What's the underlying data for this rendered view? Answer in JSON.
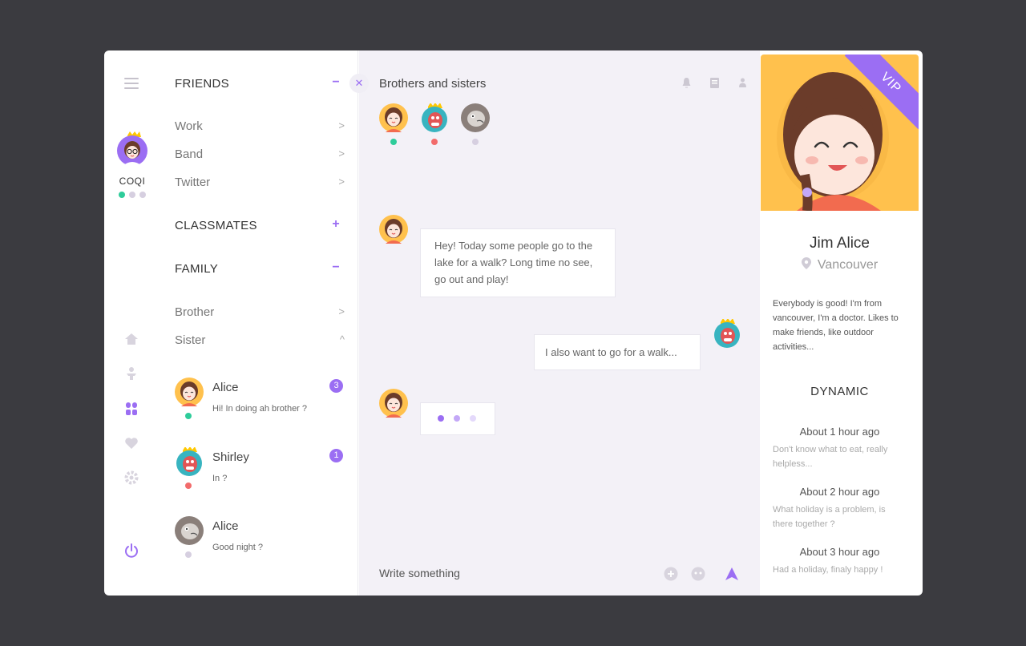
{
  "colors": {
    "accent": "#9b6ef3",
    "online": "#2ecc9a",
    "busy": "#f26b6b",
    "offline": "#d6cfe0"
  },
  "user": {
    "name": "COQI"
  },
  "sidebar_icons": [
    "menu-icon",
    "home-icon",
    "person-icon",
    "apps-icon",
    "heart-icon",
    "gear-icon",
    "power-icon"
  ],
  "friends": {
    "title": "FRIENDS",
    "toggle": "−",
    "groups": [
      {
        "label": "Work"
      },
      {
        "label": "Band"
      },
      {
        "label": "Twitter"
      }
    ]
  },
  "classmates": {
    "title": "CLASSMATES",
    "toggle": "+"
  },
  "family": {
    "title": "FAMILY",
    "toggle": "−",
    "groups": [
      {
        "label": "Brother"
      },
      {
        "label": "Sister"
      }
    ],
    "contacts": [
      {
        "name": "Alice",
        "message": "Hi! In doing ah brother ?",
        "badge": "3",
        "status": "online"
      },
      {
        "name": "Shirley",
        "message": "In ?",
        "badge": "1",
        "status": "busy"
      },
      {
        "name": "Alice",
        "message": "Good night ?",
        "status": "offline"
      }
    ]
  },
  "close_label": "✕",
  "chat": {
    "title": "Brothers and sisters",
    "messages": [
      {
        "from": "girl",
        "text": "Hey! Today some people go to the lake for a walk? Long time no see, go out and play!"
      },
      {
        "from": "me",
        "text": "I also want to go for a walk..."
      }
    ],
    "input_placeholder": "Write something"
  },
  "profile": {
    "badge": "VIP",
    "name": "Jim Alice",
    "location": "Vancouver",
    "bio": "Everybody is good! I'm from vancouver, I'm a doctor. Likes to make friends, like outdoor activities...",
    "dynamic_title": "DYNAMIC",
    "dynamics": [
      {
        "time": "About 1 hour ago",
        "text": "Don't know what to eat, really helpless..."
      },
      {
        "time": "About 2 hour ago",
        "text": "What holiday is a problem, is there together ?"
      },
      {
        "time": "About 3 hour ago",
        "text": "Had a holiday, finaly happy !"
      }
    ]
  }
}
